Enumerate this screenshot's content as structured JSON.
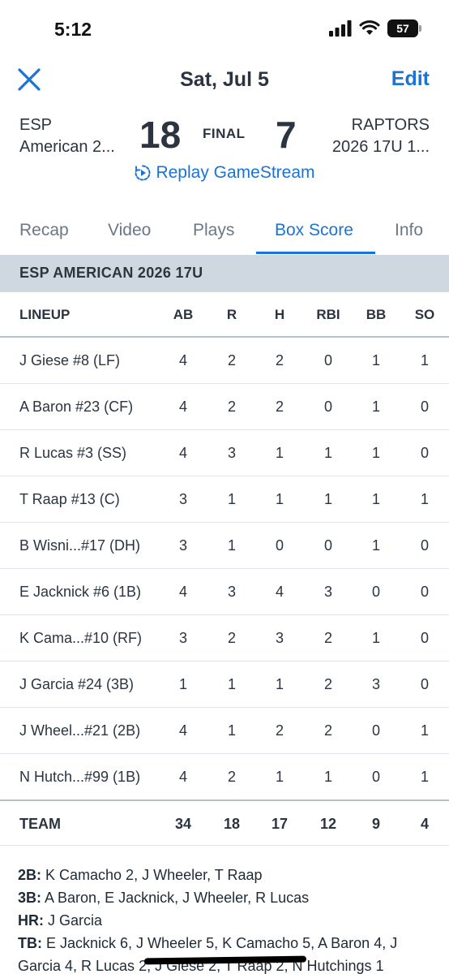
{
  "status_bar": {
    "time": "5:12",
    "battery": "57"
  },
  "header": {
    "title": "Sat, Jul 5",
    "edit_label": "Edit"
  },
  "game": {
    "home_team_line1": "ESP",
    "home_team_line2": "American 2...",
    "home_score": "18",
    "status": "FINAL",
    "away_score": "7",
    "away_team_line1": "RAPTORS",
    "away_team_line2": "2026 17U 1...",
    "replay_label": "Replay GameStream"
  },
  "tabs": [
    {
      "label": "Recap"
    },
    {
      "label": "Video"
    },
    {
      "label": "Plays"
    },
    {
      "label": "Box Score",
      "active": true
    },
    {
      "label": "Info"
    }
  ],
  "team_band": "ESP AMERICAN 2026 17U",
  "box_score": {
    "columns": [
      "LINEUP",
      "AB",
      "R",
      "H",
      "RBI",
      "BB",
      "SO"
    ],
    "rows": [
      {
        "name": "J Giese #8 (LF)",
        "stats": [
          "4",
          "2",
          "2",
          "0",
          "1",
          "1"
        ]
      },
      {
        "name": "A Baron #23 (CF)",
        "stats": [
          "4",
          "2",
          "2",
          "0",
          "1",
          "0"
        ]
      },
      {
        "name": "R Lucas #3 (SS)",
        "stats": [
          "4",
          "3",
          "1",
          "1",
          "1",
          "0"
        ]
      },
      {
        "name": "T Raap #13 (C)",
        "stats": [
          "3",
          "1",
          "1",
          "1",
          "1",
          "1"
        ]
      },
      {
        "name": "B Wisni...#17 (DH)",
        "stats": [
          "3",
          "1",
          "0",
          "0",
          "1",
          "0"
        ]
      },
      {
        "name": "E Jacknick #6 (1B)",
        "stats": [
          "4",
          "3",
          "4",
          "3",
          "0",
          "0"
        ]
      },
      {
        "name": "K Cama...#10 (RF)",
        "stats": [
          "3",
          "2",
          "3",
          "2",
          "1",
          "0"
        ]
      },
      {
        "name": "J Garcia #24 (3B)",
        "stats": [
          "1",
          "1",
          "1",
          "2",
          "3",
          "0"
        ]
      },
      {
        "name": "J Wheel...#21 (2B)",
        "stats": [
          "4",
          "1",
          "2",
          "2",
          "0",
          "1"
        ]
      },
      {
        "name": "N Hutch...#99 (1B)",
        "stats": [
          "4",
          "2",
          "1",
          "1",
          "0",
          "1"
        ]
      }
    ],
    "team_row": {
      "name": "TEAM",
      "stats": [
        "34",
        "18",
        "17",
        "12",
        "9",
        "4"
      ]
    }
  },
  "notes": {
    "doubles_label": "2B:",
    "doubles": " K Camacho 2, J Wheeler, T Raap",
    "triples_label": "3B:",
    "triples": " A Baron, E Jacknick, J Wheeler, R Lucas",
    "hr_label": "HR:",
    "hr": " J Garcia",
    "tb_label": "TB:",
    "tb_line1": " E Jacknick 6, J Wheeler 5, K Camacho 5, A Baron 4, J",
    "tb_line2": "Garcia 4, R Lucas 2, J Giese 2, T Raap 2, N Hutchings 1"
  },
  "colors": {
    "accent": "#1a73d6",
    "band": "#cfd8e0",
    "text": "#2b3440"
  }
}
